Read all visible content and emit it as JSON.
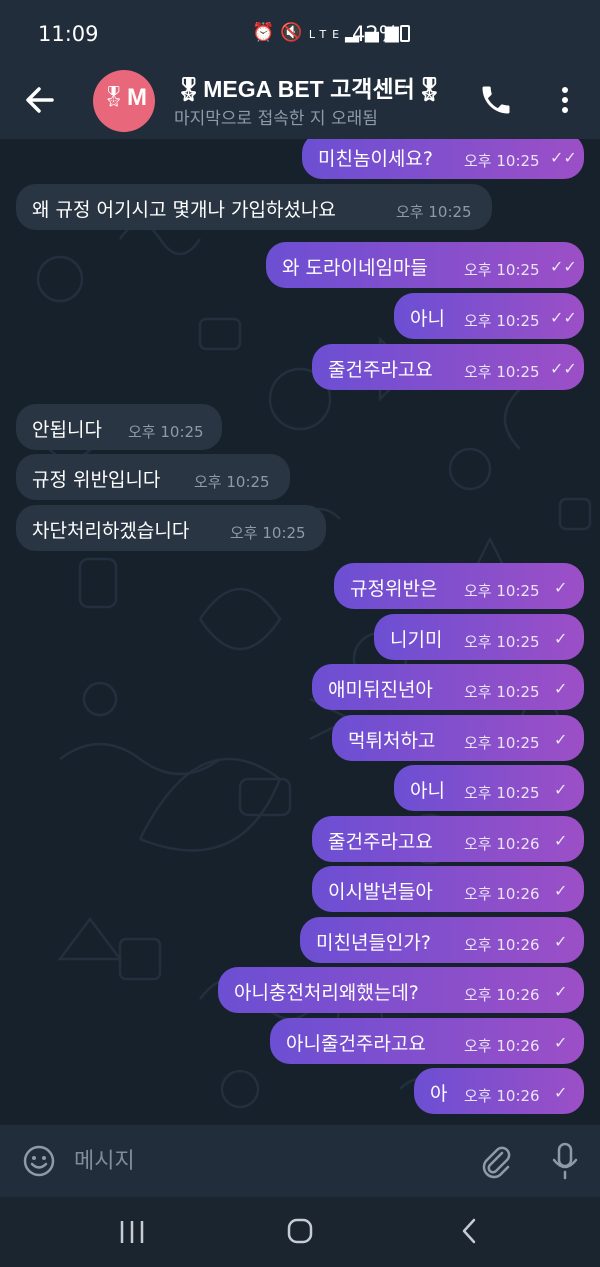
{
  "status_bar": {
    "time": "11:09",
    "battery": "42%",
    "icons": [
      "alarm-icon",
      "mute-icon",
      "lte-icon",
      "signal-icon",
      "battery-icon"
    ]
  },
  "header": {
    "title": "🎖MEGA BET 고객센터🎖",
    "subtitle": "마지막으로 접속한 지 오래됨",
    "avatar_letter": "M",
    "avatar_medal": "🎖",
    "avatar_color": "#e8677a"
  },
  "messages": [
    {
      "dir": "out",
      "text": "미친놈이세요?",
      "time": "오후 10:25",
      "status": "read"
    },
    {
      "dir": "in",
      "text": "왜 규정 어기시고 몇개나 가입하셨나요",
      "time": "오후 10:25"
    },
    {
      "dir": "out",
      "text": "와 도라이네임마들",
      "time": "오후 10:25",
      "status": "read"
    },
    {
      "dir": "out",
      "text": "아니",
      "time": "오후 10:25",
      "status": "read"
    },
    {
      "dir": "out",
      "text": "줄건주라고요",
      "time": "오후 10:25",
      "status": "read"
    },
    {
      "dir": "in",
      "text": "안됩니다",
      "time": "오후 10:25"
    },
    {
      "dir": "in",
      "text": "규정 위반입니다",
      "time": "오후 10:25"
    },
    {
      "dir": "in",
      "text": "차단처리하겠습니다",
      "time": "오후 10:25"
    },
    {
      "dir": "out",
      "text": "규정위반은",
      "time": "오후 10:25",
      "status": "sent"
    },
    {
      "dir": "out",
      "text": "니기미",
      "time": "오후 10:25",
      "status": "sent"
    },
    {
      "dir": "out",
      "text": "애미뒤진년아",
      "time": "오후 10:25",
      "status": "sent"
    },
    {
      "dir": "out",
      "text": "먹튀처하고",
      "time": "오후 10:25",
      "status": "sent"
    },
    {
      "dir": "out",
      "text": "아니",
      "time": "오후 10:25",
      "status": "sent"
    },
    {
      "dir": "out",
      "text": "줄건주라고요",
      "time": "오후 10:26",
      "status": "sent"
    },
    {
      "dir": "out",
      "text": "이시발년들아",
      "time": "오후 10:26",
      "status": "sent"
    },
    {
      "dir": "out",
      "text": "미친년들인가?",
      "time": "오후 10:26",
      "status": "sent"
    },
    {
      "dir": "out",
      "text": "아니충전처리왜했는데?",
      "time": "오후 10:26",
      "status": "sent"
    },
    {
      "dir": "out",
      "text": "아니줄건주라고요",
      "time": "오후 10:26",
      "status": "sent"
    },
    {
      "dir": "out",
      "text": "아",
      "time": "오후 10:26",
      "status": "sent"
    }
  ],
  "input": {
    "placeholder": "메시지"
  },
  "colors": {
    "outgoing_bubble_start": "#6c4fd3",
    "outgoing_bubble_end": "#9c4fc6",
    "incoming_bubble": "#2a3543",
    "background": "#17212b"
  }
}
